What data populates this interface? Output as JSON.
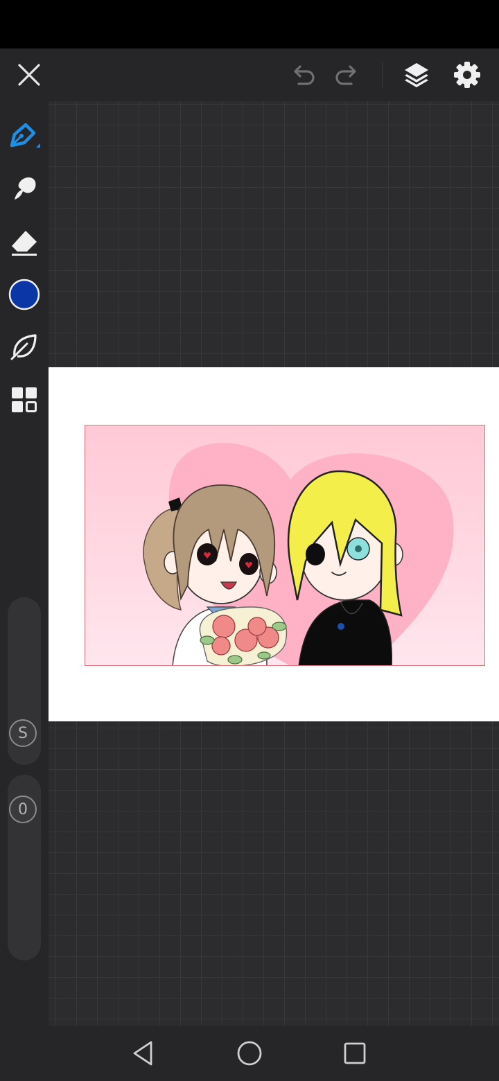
{
  "app": {
    "toolbar": {
      "close_icon": "close-icon",
      "undo_icon": "undo-icon",
      "redo_icon": "redo-icon",
      "layers_icon": "layers-icon",
      "settings_icon": "gear-icon"
    },
    "tools": [
      {
        "name": "pen",
        "icon": "pen-icon",
        "active": true
      },
      {
        "name": "smudge",
        "icon": "smudge-icon"
      },
      {
        "name": "eraser",
        "icon": "eraser-icon"
      },
      {
        "name": "color",
        "icon": "color-swatch",
        "color": "#0a36a6"
      },
      {
        "name": "blend",
        "icon": "leaf-icon"
      },
      {
        "name": "panels",
        "icon": "grid-icon"
      }
    ],
    "size_slider": {
      "label": "S"
    },
    "opacity_slider": {
      "label": "0"
    },
    "colors": {
      "accent": "#1e8fe6",
      "current_color": "#0a36a6",
      "toolbar_bg": "#262628",
      "workspace_bg": "#2c2c2f"
    },
    "navigation": {
      "back_icon": "back-triangle-icon",
      "home_icon": "home-circle-icon",
      "recents_icon": "recents-square-icon"
    }
  }
}
